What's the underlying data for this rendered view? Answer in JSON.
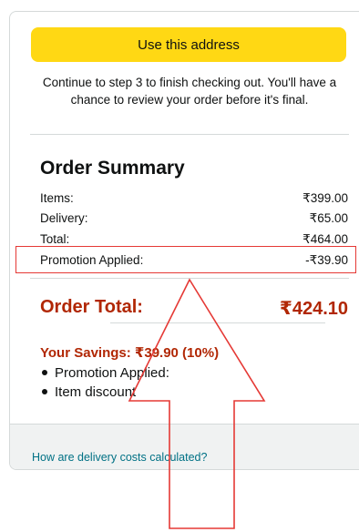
{
  "address": {
    "use_button_label": "Use this address",
    "continue_text": "Continue to step 3 to finish checking out. You'll have a chance to review your order before it's final."
  },
  "summary": {
    "title": "Order Summary",
    "rows": [
      {
        "label": "Items:",
        "value": "₹399.00"
      },
      {
        "label": "Delivery:",
        "value": "₹65.00"
      },
      {
        "label": "Total:",
        "value": "₹464.00"
      },
      {
        "label": "Promotion Applied:",
        "value": "-₹39.90"
      }
    ],
    "order_total_label": "Order Total:",
    "order_total_value": "₹424.10",
    "savings_text": "Your Savings: ₹39.90 (10%)",
    "savings_items": [
      "Promotion Applied:",
      "Item discount"
    ]
  },
  "footer": {
    "delivery_link": "How are delivery costs calculated?"
  },
  "colors": {
    "button": "#ffd814",
    "price_red": "#b12704",
    "link": "#007185",
    "annotation_red": "#e53935"
  }
}
